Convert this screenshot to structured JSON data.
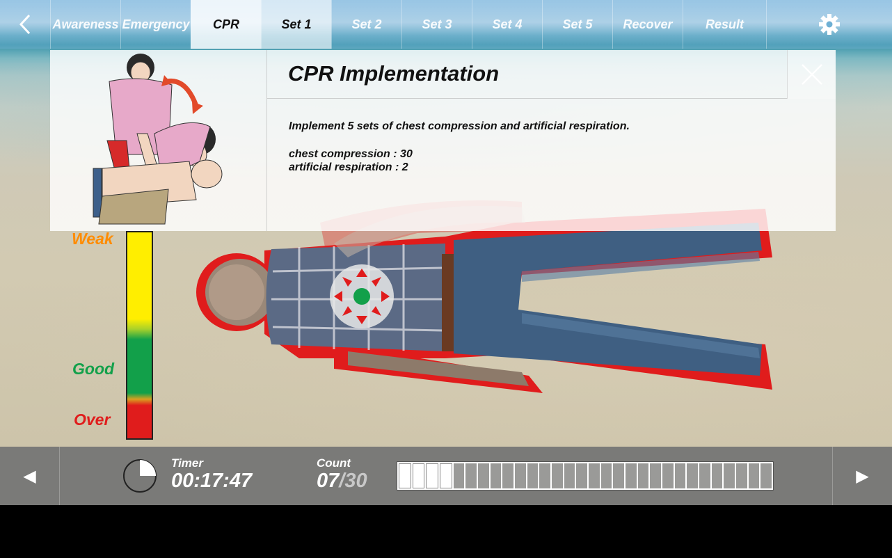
{
  "nav": {
    "tabs": [
      {
        "label": "Awareness",
        "active": false
      },
      {
        "label": "Emergency",
        "active": false
      },
      {
        "label": "CPR",
        "active": true
      },
      {
        "label": "Set 1",
        "active": true
      },
      {
        "label": "Set 2",
        "active": false
      },
      {
        "label": "Set 3",
        "active": false
      },
      {
        "label": "Set 4",
        "active": false
      },
      {
        "label": "Set 5",
        "active": false
      },
      {
        "label": "Recover",
        "active": false
      },
      {
        "label": "Result",
        "active": false
      }
    ],
    "back_icon": "chevron-left-icon",
    "settings_icon": "gear-icon"
  },
  "info": {
    "title": "CPR Implementation",
    "line1": "Implement 5 sets of chest compression and artificial respiration.",
    "line2": "chest compression : 30",
    "line3": "artificial respiration : 2",
    "close_icon": "close-icon"
  },
  "gauge": {
    "weak_label": "Weak",
    "good_label": "Good",
    "over_label": "Over",
    "colors": {
      "weak": "#ffee00",
      "good": "#12a04a",
      "over": "#e01c1c"
    }
  },
  "bottom": {
    "timer_label": "Timer",
    "timer_value": "00:17:47",
    "count_label": "Count",
    "count_done": "07",
    "count_total": "/30",
    "progress_total_segments": 30,
    "progress_filled_segments": 4,
    "prev_symbol": "◀",
    "next_symbol": "▶"
  },
  "colors": {
    "accent_red": "#e01c1c",
    "target_green": "#12a04a"
  }
}
